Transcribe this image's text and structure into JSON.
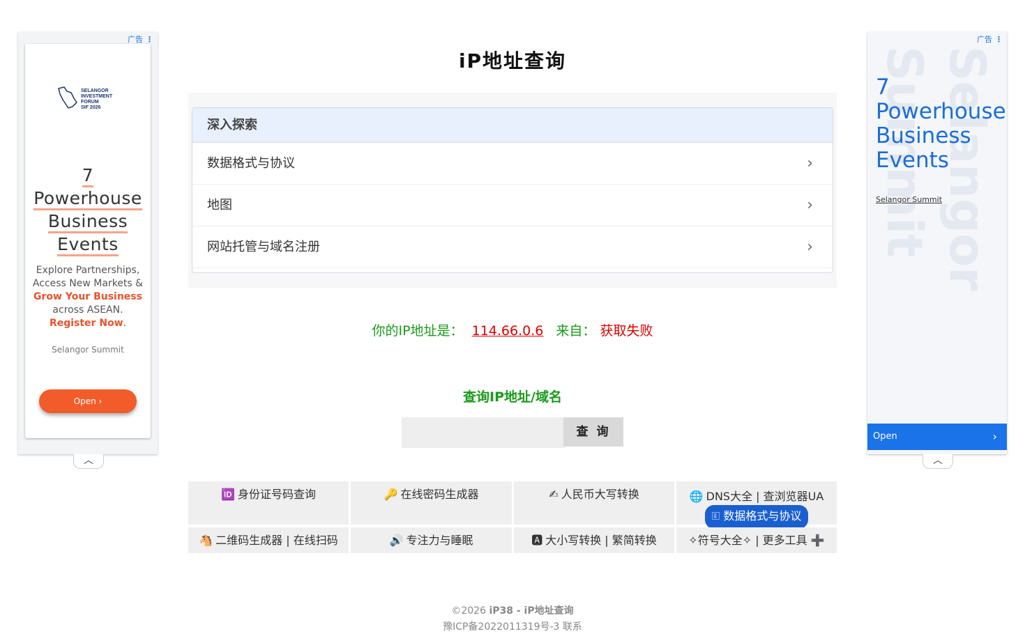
{
  "page": {
    "title": "iP地址查询"
  },
  "ads": {
    "label": "广告",
    "left": {
      "logo_lines": [
        "SELANGOR",
        "INVESTMENT",
        "FORUM",
        "SIF 2026"
      ],
      "headline": [
        "7",
        "Powerhouse",
        "Business",
        "Events"
      ],
      "desc_1": "Explore Partnerships, Access New Markets &",
      "desc_highlight": "Grow Your Business",
      "desc_2": "across ASEAN.",
      "desc_cta": "Register Now",
      "desc_end": ".",
      "brand": "Selangor Summit",
      "open_label": "Open ›"
    },
    "right": {
      "bg_text_1": "Selangor",
      "bg_text_2": "Summit",
      "headline": "7 Powerhouse Business Events",
      "brand": "Selangor Summit",
      "open_label": "Open",
      "open_chevron": "›"
    },
    "collapse_icon": "︿"
  },
  "panel": {
    "heading": "深入探索",
    "items": [
      {
        "label": "数据格式与协议"
      },
      {
        "label": "地图"
      },
      {
        "label": "网站托管与域名注册"
      }
    ],
    "chevron": "›"
  },
  "ip_info": {
    "prefix": "你的IP地址是：",
    "ip": "114.66.0.6",
    "from_label": "来自：",
    "location": "获取失败"
  },
  "query": {
    "title": "查询IP地址/域名",
    "input_value": "",
    "button_label": "查 询"
  },
  "tools": [
    {
      "icon": "🆔",
      "label": "身份证号码查询"
    },
    {
      "icon": "🔑",
      "label": "在线密码生成器"
    },
    {
      "icon": "✍",
      "label": "人民币大写转换"
    },
    {
      "icon": "🌐",
      "label": "DNS大全 | 查浏览器UA",
      "pill": "🗉 数据格式与协议"
    },
    {
      "icon": "🐴",
      "label": "二维码生成器 | 在线扫码"
    },
    {
      "icon": "🔊",
      "label": "专注力与睡眠"
    },
    {
      "icon": "🅰",
      "label": "大小写转换 | 繁简转换"
    },
    {
      "icon": "",
      "label": "✧符号大全✧ | 更多工具 ➕"
    }
  ],
  "footer": {
    "copyright": "©2026",
    "site": "iP38 - iP地址查询",
    "icp": "豫ICP备2022011319号-3",
    "contact": "联系"
  }
}
